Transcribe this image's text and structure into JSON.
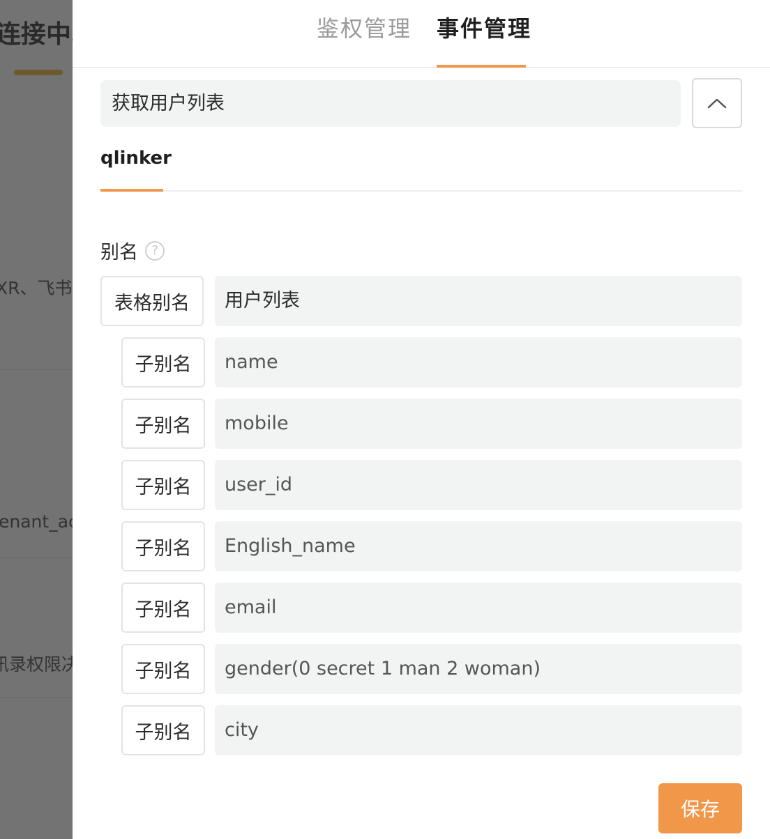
{
  "background": {
    "title": "连接中心",
    "texts": [
      "XR、飞书",
      "enant_acc",
      "讯录权限决"
    ]
  },
  "tabs": [
    {
      "label": "鉴权管理",
      "active": false
    },
    {
      "label": "事件管理",
      "active": true
    }
  ],
  "event": {
    "name": "获取用户列表",
    "collapse_icon": "chevron-up-icon"
  },
  "sub_tab": {
    "label": "qlinker"
  },
  "alias_section": {
    "label": "别名",
    "help_icon": "question-circle-icon",
    "table_alias_label": "表格别名",
    "table_alias_value": "用户列表",
    "sub_alias_label": "子别名",
    "sub_aliases": [
      "name",
      "mobile",
      "user_id",
      "English_name",
      "email",
      "gender(0 secret 1 man 2 woman)",
      "city"
    ]
  },
  "save_label": "保存",
  "colors": {
    "accent": "#f0974a",
    "input_bg": "#f2f3f3"
  }
}
